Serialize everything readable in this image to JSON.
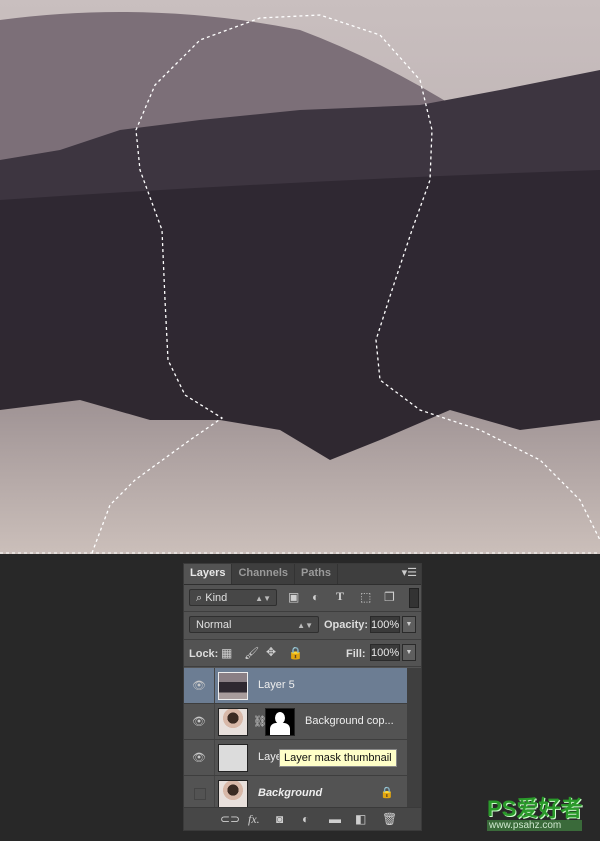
{
  "panel": {
    "tabs": [
      {
        "label": "Layers",
        "active": true
      },
      {
        "label": "Channels"
      },
      {
        "label": "Paths"
      }
    ],
    "filter": {
      "value": "Kind"
    },
    "blend_mode": "Normal",
    "opacity_label": "Opacity:",
    "opacity_value": "100%",
    "lock_label": "Lock:",
    "fill_label": "Fill:",
    "fill_value": "100%",
    "layers": [
      {
        "name": "Layer 5",
        "visible": true,
        "selected": true
      },
      {
        "name": "Background cop...",
        "visible": true,
        "has_mask": true
      },
      {
        "name": "Laye",
        "visible": true
      },
      {
        "name": "Background",
        "visible": false,
        "locked": true
      }
    ],
    "tooltip": "Layer mask thumbnail"
  },
  "watermark": {
    "text": "PS爱好者",
    "url": "www.psahz.com"
  },
  "colors": {
    "selected_layer": "#6c7d93",
    "panel_bg": "#535353",
    "tooltip_bg": "#ffffc8"
  }
}
